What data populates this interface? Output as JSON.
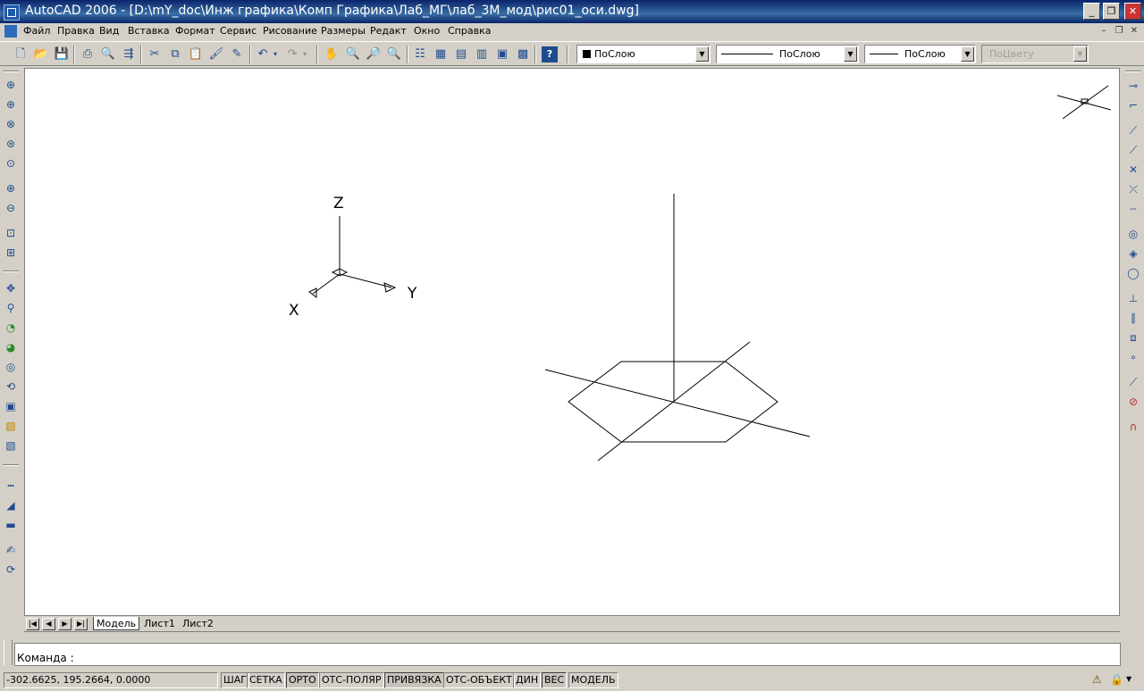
{
  "window": {
    "title": "AutoCAD 2006 - [D:\\mY_doc\\Инж графика\\Комп Графика\\Лаб_МГ\\лаб_3М_мод\\рис01_оси.dwg]",
    "minimize": "_",
    "restore": "❐",
    "close": "✕"
  },
  "menu": {
    "items": [
      "Файл",
      "Правка",
      "Вид",
      "Вставка",
      "Формат",
      "Сервис",
      "Рисование",
      "Размеры",
      "Редакт",
      "Окно",
      "Справка"
    ],
    "doc_minimize": "–",
    "doc_restore": "❐",
    "doc_close": "✕"
  },
  "toolbar": {
    "color_combo": "ПоСлою",
    "linetype_combo": "ПоСлою",
    "lineweight_combo": "ПоСлою",
    "plotstyle_combo": "ПоЦвету",
    "color_swatch": "#000000"
  },
  "drawing": {
    "ucs": {
      "x_label": "X",
      "y_label": "Y",
      "z_label": "Z"
    }
  },
  "tabs": {
    "items": [
      "Модель",
      "Лист1",
      "Лист2"
    ],
    "active": "Модель"
  },
  "command": {
    "prompt": "Команда :"
  },
  "status": {
    "coordinates": "-302.6625, 195.2664, 0.0000",
    "buttons": [
      {
        "label": "ШАГ",
        "on": false
      },
      {
        "label": "СЕТКА",
        "on": false
      },
      {
        "label": "ОРТО",
        "on": true
      },
      {
        "label": "ОТС-ПОЛЯР",
        "on": false
      },
      {
        "label": "ПРИВЯЗКА",
        "on": true
      },
      {
        "label": "ОТС-ОБЪЕКТ",
        "on": false
      },
      {
        "label": "ДИН",
        "on": false
      },
      {
        "label": "ВЕС",
        "on": true
      },
      {
        "label": "МОДЕЛЬ",
        "on": false
      }
    ]
  }
}
